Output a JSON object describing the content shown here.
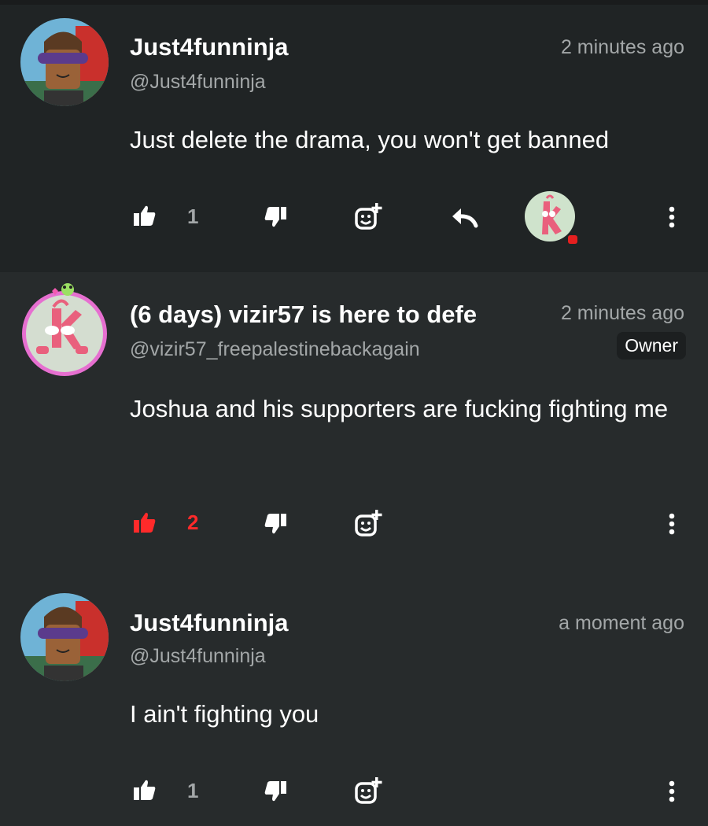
{
  "comments": [
    {
      "username": "Just4funninja",
      "handle": "@Just4funninja",
      "time": "2 minutes ago",
      "text": "Just delete the drama, you won't get banned",
      "likes": "1"
    },
    {
      "username": "(6 days) vizir57 is here to defe",
      "handle": "@vizir57_freepalestinebackagain",
      "time": "2 minutes ago",
      "badge": "Owner",
      "text": "Joshua and his supporters are fucking fighting me",
      "likes": "2"
    },
    {
      "username": "Just4funninja",
      "handle": "@Just4funninja",
      "time": "a moment ago",
      "text": "I ain't fighting you",
      "likes": "1"
    }
  ],
  "colors": {
    "liked": "#ff2a2a",
    "muted": "#a3a7a8",
    "background": "#272b2c",
    "highlight_background": "#202425"
  }
}
